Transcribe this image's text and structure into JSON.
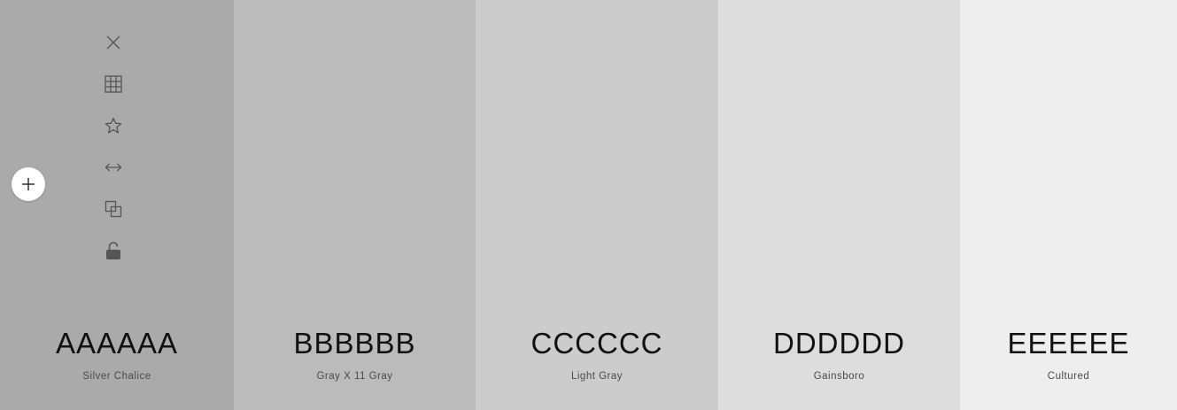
{
  "swatches": [
    {
      "hex": "AAAAAA",
      "name": "Silver Chalice",
      "color": "#AAAAAA"
    },
    {
      "hex": "BBBBBB",
      "name": "Gray X 11 Gray",
      "color": "#BBBBBB"
    },
    {
      "hex": "CCCCCC",
      "name": "Light Gray",
      "color": "#CCCCCC"
    },
    {
      "hex": "DDDDDD",
      "name": "Gainsboro",
      "color": "#DDDDDD"
    },
    {
      "hex": "EEEEEE",
      "name": "Cultured",
      "color": "#EEEEEE"
    }
  ],
  "toolbar": {
    "icons": [
      "close-icon",
      "grid-icon",
      "star-icon",
      "arrows-horizontal-icon",
      "copy-icon",
      "unlock-icon"
    ]
  },
  "add_button": {
    "icon": "plus-icon"
  },
  "colors": {
    "icon": "#555555",
    "hex_text": "#111111",
    "name_text": "#4a4a4a"
  }
}
